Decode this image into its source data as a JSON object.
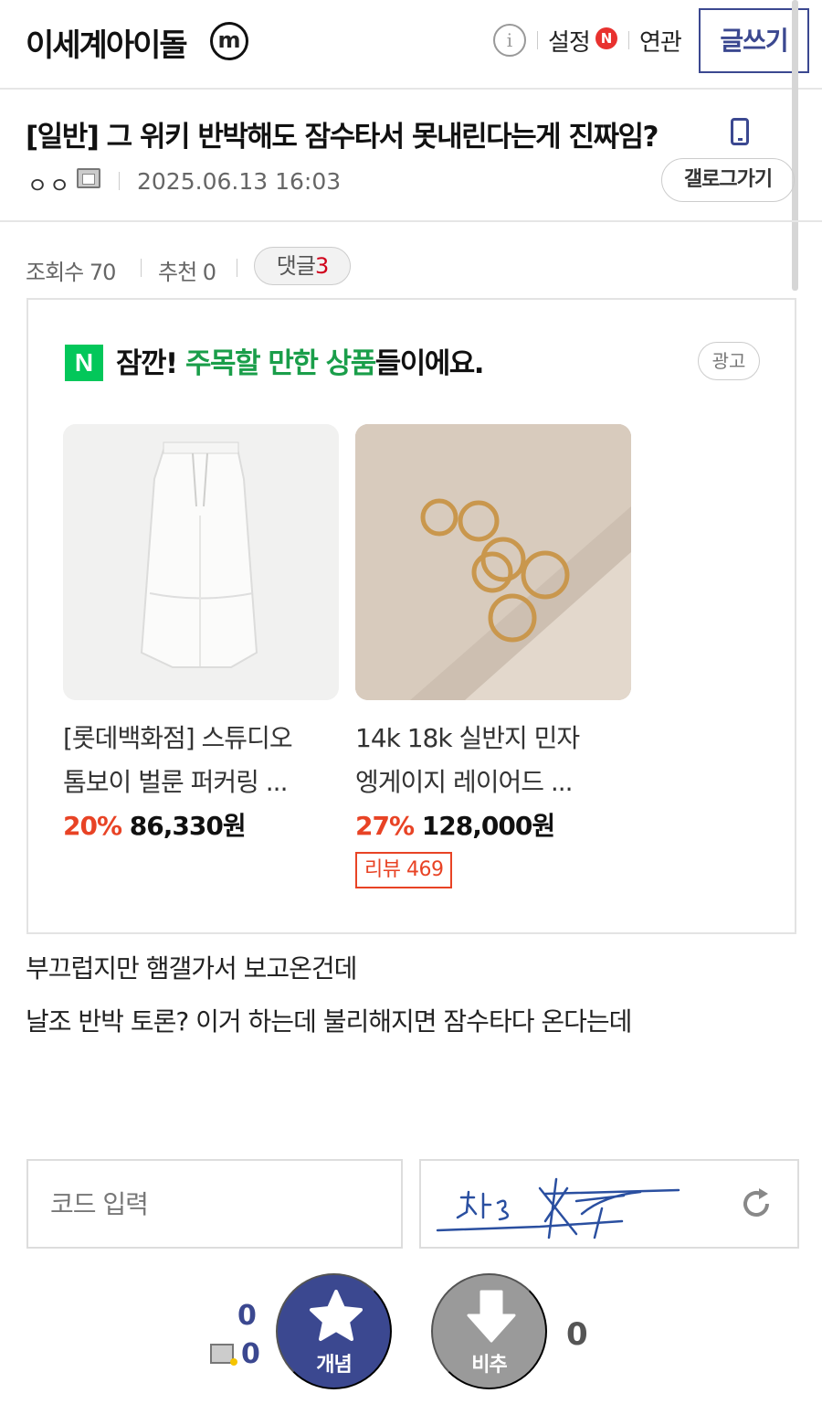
{
  "header": {
    "gallery_name": "이세계아이돌",
    "minor_badge": "m",
    "settings_label": "설정",
    "new_badge": "N",
    "related_label": "연관",
    "write_label": "글쓰기"
  },
  "post": {
    "title": "[일반] 그 위키 반박해도 잠수타서 못내린다는게 진짜임?",
    "author": "ㅇㅇ",
    "date": "2025.06.13 16:03",
    "go_gallery_label": "갤로그가기",
    "stats": {
      "views_label": "조회수 70",
      "recommend_label": "추천 0",
      "comments_label": "댓글",
      "comments_count": "3"
    },
    "body_lines": [
      "부끄럽지만 햄갤가서 보고온건데",
      "날조 반박 토론? 이거 하는데 불리해지면 잠수타다 온다는데"
    ]
  },
  "ad": {
    "logo": "N",
    "heading_prefix": "잠깐! ",
    "heading_highlight": "주목할 만한 상품",
    "heading_suffix": "들이에요.",
    "tag": "광고",
    "products": [
      {
        "name_line1": "[롯데백화점] 스튜디오",
        "name_line2": "톰보이 벌룬 퍼커링 ...",
        "discount": "20%",
        "price": "86,330원"
      },
      {
        "name_line1": "14k 18k 실반지 민자",
        "name_line2": "엥게이지 레이어드 ...",
        "discount": "27%",
        "price": "128,000원",
        "review": "리뷰 469"
      }
    ]
  },
  "captcha": {
    "placeholder": "코드 입력"
  },
  "votes": {
    "up_count": "0",
    "fixed_up_count": "0",
    "up_label": "개념",
    "down_label": "비추",
    "down_count": "0"
  }
}
